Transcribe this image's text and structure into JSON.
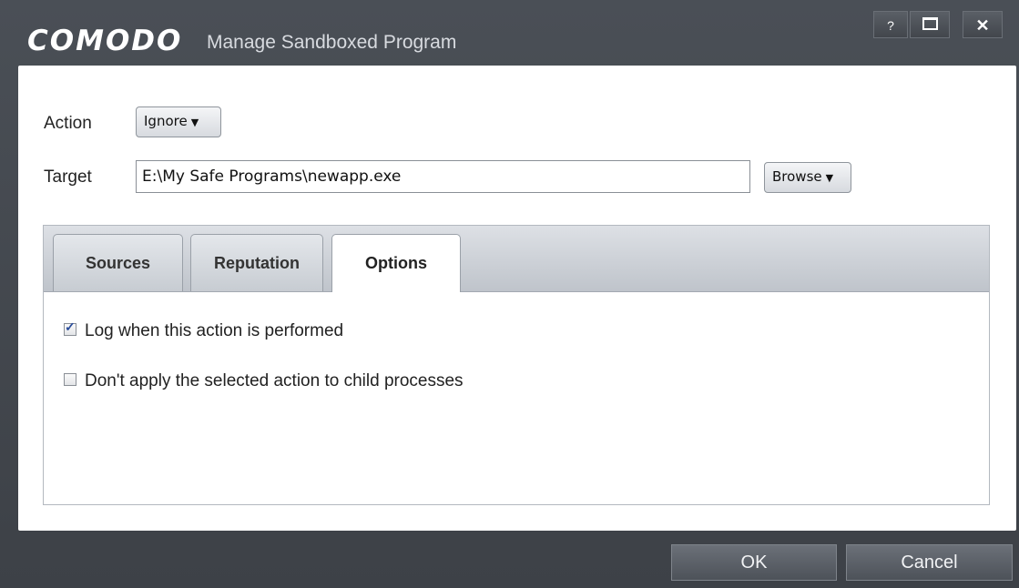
{
  "window": {
    "brand": "COMODO",
    "title": "Manage Sandboxed Program",
    "help": "?",
    "close": "✕"
  },
  "form": {
    "action_label": "Action",
    "action_value": "Ignore",
    "target_label": "Target",
    "target_value": "E:\\My Safe Programs\\newapp.exe",
    "browse_label": "Browse"
  },
  "tabs": [
    {
      "label": "Sources",
      "active": false
    },
    {
      "label": "Reputation",
      "active": false
    },
    {
      "label": "Options",
      "active": true
    }
  ],
  "options": [
    {
      "label": "Log when this action is performed",
      "checked": true
    },
    {
      "label": "Don't apply the selected action to child processes",
      "checked": false
    }
  ],
  "footer": {
    "ok": "OK",
    "cancel": "Cancel"
  }
}
